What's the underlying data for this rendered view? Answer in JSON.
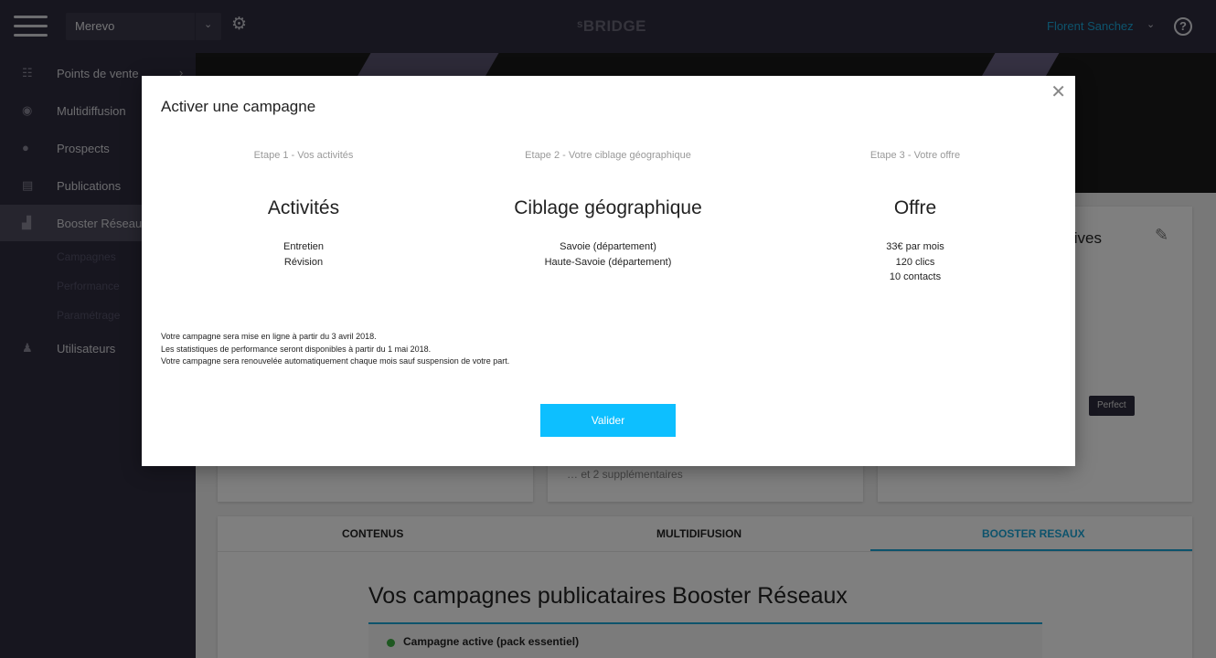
{
  "topbar": {
    "org": "Merevo",
    "brand": "BRIDGE",
    "user": "Florent Sanchez"
  },
  "sidebar": {
    "items": [
      {
        "label": "Points de vente",
        "icon": "store-list-icon"
      },
      {
        "label": "Multidiffusion",
        "icon": "eye-icon"
      },
      {
        "label": "Prospects",
        "icon": "chat-bubble-icon"
      },
      {
        "label": "Publications",
        "icon": "newspaper-icon"
      },
      {
        "label": "Booster Réseaux",
        "icon": "bar-chart-icon"
      },
      {
        "label": "Utilisateurs",
        "icon": "user-icon"
      }
    ],
    "subitems": [
      "Campagnes",
      "Performance",
      "Paramétrage"
    ]
  },
  "background": {
    "card_title_partial": "tives",
    "tag": "Perfect",
    "more": "… et 2 supplémentaires",
    "tabs": [
      "CONTENUS",
      "MULTIDIFUSION",
      "BOOSTER RESAUX"
    ],
    "section_title": "Vos campagnes publicataires Booster Réseaux",
    "campaign": "Campagne active (pack essentiel)"
  },
  "modal": {
    "title": "Activer une campagne",
    "steps": [
      {
        "label": "Etape 1 - Vos activités",
        "heading": "Activités",
        "lines": [
          "Entretien",
          "Révision"
        ]
      },
      {
        "label": "Etape 2 - Votre ciblage géographique",
        "heading": "Ciblage géographique",
        "lines": [
          "Savoie (département)",
          "Haute-Savoie (département)"
        ]
      },
      {
        "label": "Etape 3 - Votre offre",
        "heading": "Offre",
        "lines": [
          "33€ par mois",
          "120 clics",
          "10 contacts"
        ]
      }
    ],
    "notes": [
      "Votre campagne sera mise en ligne à partir du 3 avril 2018.",
      "Les statistiques de performance seront disponibles à partir du 1 mai 2018.",
      "Votre campagne sera renouvelée automatiquement chaque mois sauf suspension de votre part."
    ],
    "button": "Valider"
  },
  "colors": {
    "accent": "#1aa6d9",
    "button": "#0dbfff",
    "sidebar": "#2f2d3e",
    "status_active": "#3cb043"
  }
}
